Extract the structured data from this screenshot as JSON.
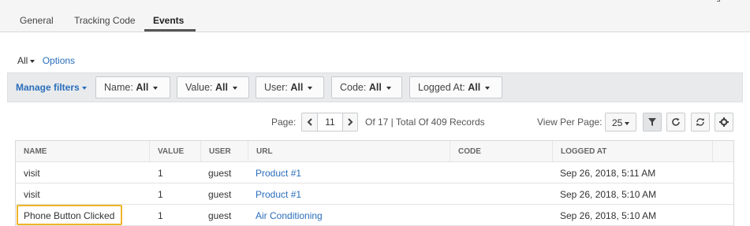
{
  "tabs": [
    {
      "label": "General",
      "active": false
    },
    {
      "label": "Tracking Code",
      "active": false
    },
    {
      "label": "Events",
      "active": true
    }
  ],
  "view": {
    "scope_label": "All",
    "options_label": "Options"
  },
  "filters": {
    "manage_label": "Manage filters",
    "items": [
      {
        "label": "Name:",
        "value": "All"
      },
      {
        "label": "Value:",
        "value": "All"
      },
      {
        "label": "User:",
        "value": "All"
      },
      {
        "label": "Code:",
        "value": "All"
      },
      {
        "label": "Logged At:",
        "value": "All"
      }
    ]
  },
  "pagination": {
    "page_label": "Page:",
    "current_page": "11",
    "summary": "Of 17 | Total Of 409 Records",
    "prev_icon": "chevron-left-icon",
    "next_icon": "chevron-right-icon",
    "per_page_label": "View Per Page:",
    "per_page_value": "25"
  },
  "toolbar_icons": [
    "filter-icon",
    "refresh-icon",
    "sync-icon",
    "gear-icon"
  ],
  "table": {
    "columns": [
      "NAME",
      "VALUE",
      "USER",
      "URL",
      "CODE",
      "LOGGED AT"
    ],
    "rows": [
      {
        "name": "visit",
        "value": "1",
        "user": "guest",
        "url": "Product #1",
        "code": "",
        "logged_at": "Sep 26, 2018, 5:11 AM"
      },
      {
        "name": "visit",
        "value": "1",
        "user": "guest",
        "url": "Product #1",
        "code": "",
        "logged_at": "Sep 26, 2018, 5:10 AM"
      },
      {
        "name": "Phone Button Clicked",
        "value": "1",
        "user": "guest",
        "url": "Air Conditioning",
        "code": "",
        "logged_at": "Sep 26, 2018, 5:10 AM"
      }
    ]
  },
  "colors": {
    "link": "#2a6ebb",
    "highlight": "#f0b429",
    "filterbar_bg": "#e8eaec"
  }
}
